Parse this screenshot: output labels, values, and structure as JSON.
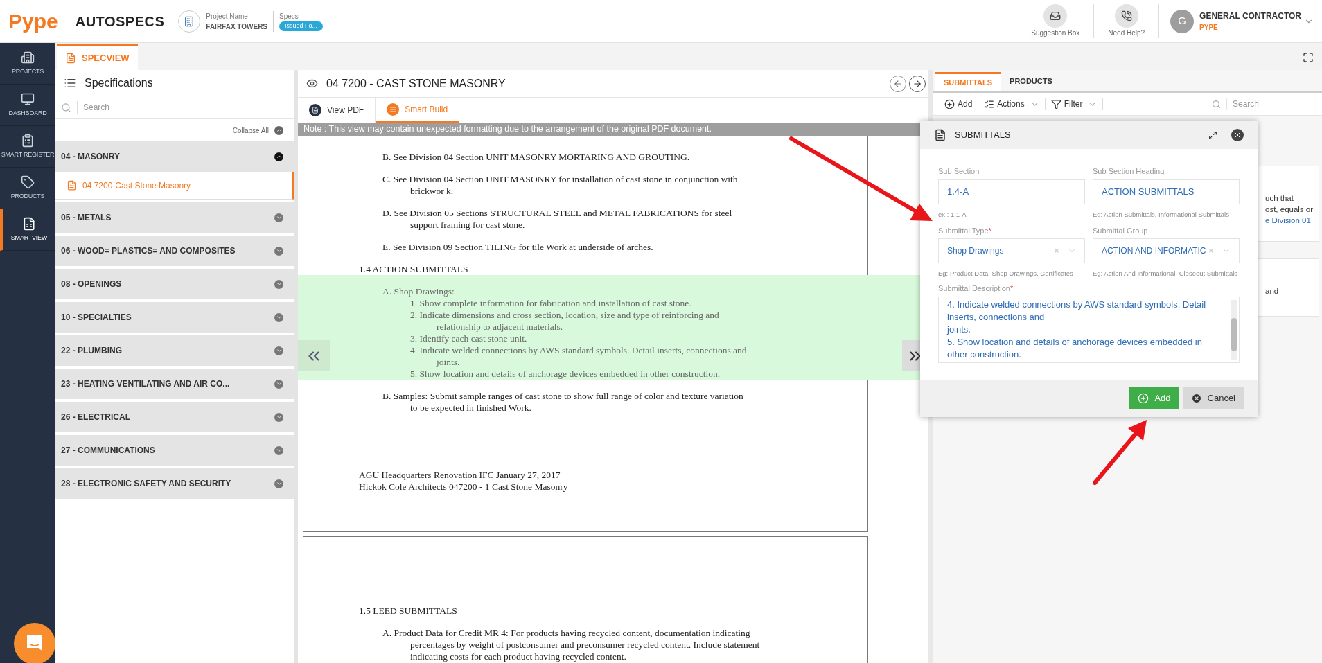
{
  "header": {
    "logo": "Pype",
    "app_name": "AUTOSPECS",
    "project": {
      "label": "Project Name",
      "value": "FAIRFAX TOWERS"
    },
    "specs": {
      "label": "Specs",
      "badge": "Issued Fo..."
    },
    "actions": [
      {
        "kind": "suggestion",
        "label": "Suggestion Box"
      },
      {
        "kind": "help",
        "label": "Need Help?"
      }
    ],
    "user": {
      "initial": "G",
      "role": "GENERAL CONTRACTOR",
      "company": "PYPE"
    }
  },
  "nav": [
    {
      "kind": "projects",
      "label": "PROJECTS",
      "selected": false
    },
    {
      "kind": "dashboard",
      "label": "DASHBOARD",
      "selected": false
    },
    {
      "kind": "register",
      "label": "SMART REGISTER",
      "selected": false
    },
    {
      "kind": "products",
      "label": "PRODUCTS",
      "selected": false
    },
    {
      "kind": "smartview",
      "label": "SMARTVIEW",
      "selected": true
    }
  ],
  "module_tab": {
    "label": "SPECVIEW"
  },
  "specs_panel": {
    "title": "Specifications",
    "search_placeholder": "Search",
    "collapse_all": "Collapse All",
    "groups": [
      {
        "label": "04 - MASONRY",
        "expanded": true,
        "children": [
          {
            "label": "04 7200-Cast Stone Masonry",
            "selected": true
          }
        ]
      },
      {
        "label": "05 - METALS",
        "expanded": false
      },
      {
        "label": "06 - WOOD= PLASTICS= AND COMPOSITES",
        "expanded": false
      },
      {
        "label": "08 - OPENINGS",
        "expanded": false
      },
      {
        "label": "10 - SPECIALTIES",
        "expanded": false
      },
      {
        "label": "22 - PLUMBING",
        "expanded": false
      },
      {
        "label": "23 - HEATING VENTILATING AND AIR CO...",
        "expanded": false
      },
      {
        "label": "26 - ELECTRICAL",
        "expanded": false
      },
      {
        "label": "27 - COMMUNICATIONS",
        "expanded": false
      },
      {
        "label": "28 - ELECTRONIC SAFETY AND SECURITY",
        "expanded": false
      }
    ]
  },
  "document": {
    "title": "04 7200 - CAST STONE MASONRY",
    "tabs": [
      {
        "kind": "pdf",
        "label": "View PDF",
        "selected": false
      },
      {
        "kind": "build",
        "label": "Smart Build",
        "selected": true
      }
    ],
    "note": "Note : This view may contain unexpected formatting due to the arrangement of the original PDF document.",
    "pages": [
      {
        "blocks": [
          {
            "kind": "para",
            "highlighted": false,
            "lines": [
              "B. See Division 04 Section UNIT MASONRY MORTARING AND GROUTING."
            ]
          },
          {
            "kind": "para",
            "highlighted": false,
            "lines": [
              "C. See Division 04 Section UNIT MASONRY for installation of cast stone in conjunction with",
              "brickwor k."
            ]
          },
          {
            "kind": "para",
            "highlighted": false,
            "lines": [
              "D. See Division 05 Sections STRUCTURAL STEEL and METAL FABRICATIONS for steel",
              "support framing for cast stone."
            ]
          },
          {
            "kind": "para",
            "highlighted": false,
            "lines": [
              "E. See Division 09 Section TILING for tile Work at underside of arches."
            ]
          },
          {
            "kind": "heading",
            "highlighted": false,
            "lines": [
              "1.4 ACTION SUBMITTALS"
            ]
          },
          {
            "kind": "para",
            "highlighted": true,
            "lines": [
              "A. Shop Drawings:"
            ]
          },
          {
            "kind": "item",
            "highlighted": true,
            "lines": [
              "1. Show complete information for fabrication and installation of cast stone."
            ]
          },
          {
            "kind": "item",
            "highlighted": true,
            "lines": [
              "2. Indicate dimensions and cross section, location, size and type of reinforcing and",
              "relationship to adjacent materials."
            ]
          },
          {
            "kind": "item",
            "highlighted": true,
            "lines": [
              "3. Identify each cast stone unit."
            ]
          },
          {
            "kind": "item",
            "highlighted": true,
            "lines": [
              "4. Indicate welded connections by AWS standard symbols. Detail inserts, connections and",
              "joints."
            ]
          },
          {
            "kind": "item",
            "highlighted": true,
            "lines": [
              "5. Show location and details of anchorage devices embedded in other construction."
            ]
          },
          {
            "kind": "para",
            "highlighted": false,
            "lines": [
              "B. Samples: Submit sample ranges of cast stone to show full range of color and texture variation",
              "to be expected in finished Work."
            ]
          },
          {
            "kind": "footer",
            "highlighted": false,
            "lines": [
              "AGU Headquarters Renovation IFC January 27, 2017",
              "Hickok Cole Architects 047200 - 1 Cast Stone Masonry"
            ]
          }
        ]
      },
      {
        "blocks": [
          {
            "kind": "heading",
            "highlighted": false,
            "lines": [
              "1.5 LEED SUBMITTALS"
            ]
          },
          {
            "kind": "para",
            "highlighted": false,
            "lines": [
              "A. Product Data for Credit MR 4: For products having recycled content, documentation indicating",
              "percentages by weight of postconsumer and preconsumer recycled content. Include statement",
              "indicating costs for each product having recycled content."
            ]
          }
        ]
      }
    ]
  },
  "side_panel": {
    "tabs": [
      {
        "label": "SUBMITTALS",
        "selected": true
      },
      {
        "label": "PRODUCTS",
        "selected": false
      }
    ],
    "toolbar": [
      {
        "kind": "add",
        "label": "Add"
      },
      {
        "kind": "actions",
        "label": "Actions"
      },
      {
        "kind": "filter",
        "label": "Filter"
      }
    ],
    "search_placeholder": "Search",
    "cards": [
      {
        "lines": [
          {
            "text": "uch that",
            "link": false
          },
          {
            "text": "ost, equals or",
            "link": false
          },
          {
            "text": "e Division 01",
            "link": true
          }
        ]
      },
      {
        "lines": [
          {
            "text": "and",
            "link": false
          }
        ]
      }
    ]
  },
  "modal": {
    "title": "SUBMITTALS",
    "fields": [
      {
        "kind": "text",
        "label": "Sub Section",
        "value": "1.4-A",
        "hint": "ex.: 1.1-A"
      },
      {
        "kind": "text",
        "label": "Sub Section Heading",
        "value": "ACTION SUBMITTALS",
        "hint": "Eg: Action Submittals, Informational Submittals"
      },
      {
        "kind": "select",
        "label": "Submittal Type",
        "required_mark": "*",
        "value": "Shop Drawings",
        "hint": "Eg: Product Data, Shop Drawings, Certificates"
      },
      {
        "kind": "select",
        "label": "Submittal Group",
        "value": "ACTION AND INFORMATIC",
        "hint": "Eg: Action And Informational, Closeout Submittals"
      },
      {
        "kind": "textarea",
        "label": "Submittal Description",
        "required_mark": "*",
        "value": "4. Indicate welded connections by AWS standard symbols. Detail\ninserts, connections and\njoints.\n5. Show location and details of anchorage devices embedded in\nother construction."
      }
    ],
    "buttons": [
      {
        "kind": "primary",
        "label": "Add"
      },
      {
        "kind": "secondary",
        "label": "Cancel"
      }
    ]
  }
}
